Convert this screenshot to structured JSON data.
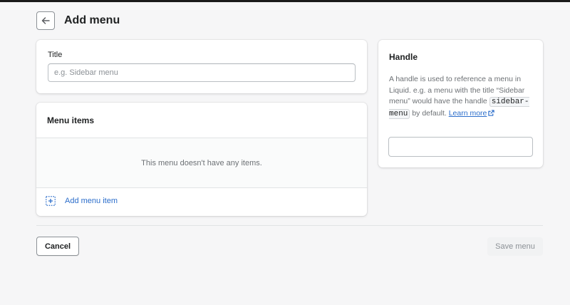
{
  "header": {
    "back_icon": "arrow-left-icon",
    "title": "Add menu"
  },
  "title_card": {
    "label": "Title",
    "input_value": "",
    "placeholder": "e.g. Sidebar menu"
  },
  "menu_items_card": {
    "heading": "Menu items",
    "empty_message": "This menu doesn't have any items.",
    "add_icon": "dashed-plus-icon",
    "add_label": "Add menu item"
  },
  "handle_card": {
    "heading": "Handle",
    "description_part1": "A handle is used to reference a menu in Liquid. e.g. a menu with the title “Sidebar menu” would have the handle ",
    "code": "sidebar-menu",
    "description_part2": " by default. ",
    "link_text": "Learn more",
    "link_icon": "external-link-icon",
    "input_value": ""
  },
  "footer": {
    "cancel_label": "Cancel",
    "save_label": "Save menu"
  },
  "colors": {
    "background": "#f6f6f7",
    "link": "#2c6ecb",
    "text": "#202223",
    "subdued": "#6d7175",
    "disabled_bg": "#f1f2f3"
  }
}
